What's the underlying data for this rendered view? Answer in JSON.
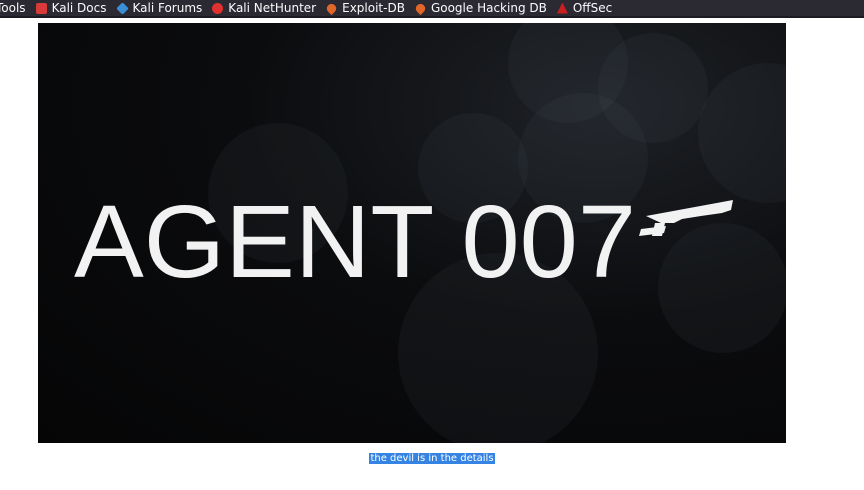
{
  "bookmarks": [
    {
      "label": "Tools",
      "icon": "none"
    },
    {
      "label": "Kali Docs",
      "icon": "kali-docs-icon"
    },
    {
      "label": "Kali Forums",
      "icon": "kali-forums-icon"
    },
    {
      "label": "Kali NetHunter",
      "icon": "kali-nethunter-icon"
    },
    {
      "label": "Exploit-DB",
      "icon": "exploit-db-icon"
    },
    {
      "label": "Google Hacking DB",
      "icon": "google-hacking-db-icon"
    },
    {
      "label": "OffSec",
      "icon": "offsec-icon"
    }
  ],
  "hero": {
    "title": "AGENT 007",
    "background_color": "#050506"
  },
  "caption": {
    "text": "the devil is in the details",
    "selection_color": "#3584e4"
  }
}
